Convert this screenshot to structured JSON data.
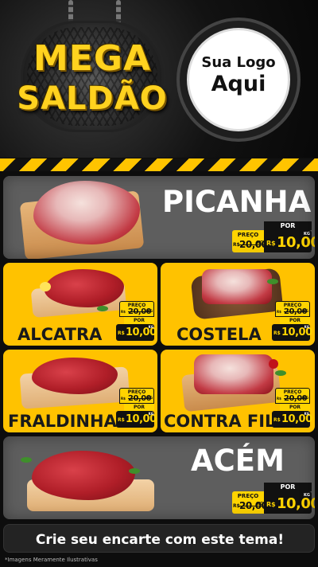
{
  "header": {
    "title_line1": "MEGA",
    "title_line2": "SALDÃO",
    "logo_line1": "Sua Logo",
    "logo_line2": "Aqui"
  },
  "products": [
    {
      "name": "PICANHA",
      "price_label": "PREÇO",
      "old_price": "20,00",
      "por_label": "POR",
      "currency": "R$",
      "price": "10,00",
      "unit": "KG"
    },
    {
      "name": "ALCATRA",
      "price_label": "PREÇO",
      "old_price": "20,00",
      "por_label": "POR",
      "currency": "R$",
      "price": "10,00",
      "unit": "KG"
    },
    {
      "name": "COSTELA",
      "price_label": "PREÇO",
      "old_price": "20,00",
      "por_label": "POR",
      "currency": "R$",
      "price": "10,00",
      "unit": "KG"
    },
    {
      "name": "FRALDINHA",
      "price_label": "PREÇO",
      "old_price": "20,00",
      "por_label": "POR",
      "currency": "R$",
      "price": "10,00",
      "unit": "KG"
    },
    {
      "name": "CONTRA FILÉ",
      "price_label": "PREÇO",
      "old_price": "20,00",
      "por_label": "POR",
      "currency": "R$",
      "price": "10,00",
      "unit": "KG"
    },
    {
      "name": "ACÉM",
      "price_label": "PREÇO",
      "old_price": "20,00",
      "por_label": "POR",
      "currency": "R$",
      "price": "10,00",
      "unit": "KG"
    }
  ],
  "banner": {
    "text": "Crie seu encarte com este tema!"
  },
  "footnote": "*Imagens Meramente Ilustrativas",
  "colors": {
    "accent_yellow": "#ffc200",
    "card_gray": "#5e5e5e",
    "background": "#0d0d0d",
    "price_box": "#111111"
  }
}
